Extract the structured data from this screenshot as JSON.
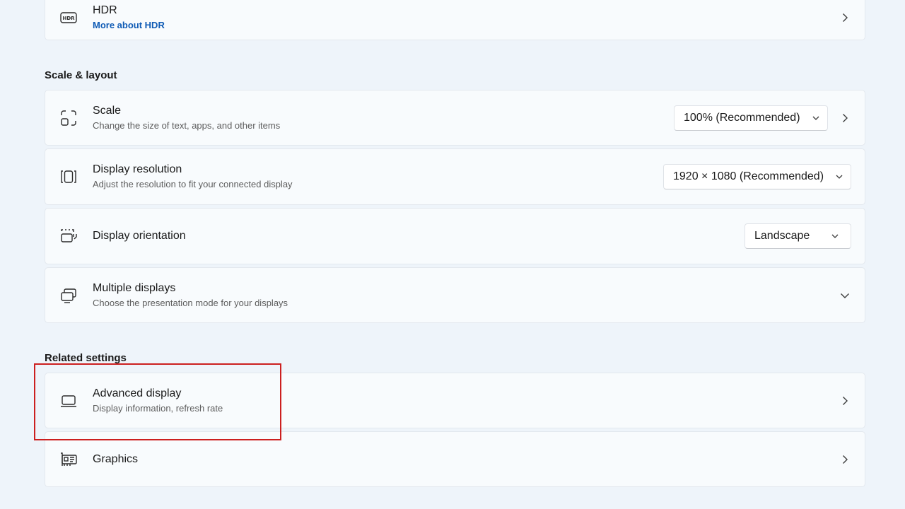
{
  "hdr": {
    "title": "HDR",
    "link": "More about HDR",
    "icon": "hdr-icon"
  },
  "sections": {
    "scale_layout": "Scale & layout",
    "related": "Related settings"
  },
  "scale": {
    "title": "Scale",
    "subtitle": "Change the size of text, apps, and other items",
    "value": "100% (Recommended)",
    "icon": "scale-icon"
  },
  "resolution": {
    "title": "Display resolution",
    "subtitle": "Adjust the resolution to fit your connected display",
    "value": "1920 × 1080 (Recommended)",
    "icon": "resolution-icon"
  },
  "orientation": {
    "title": "Display orientation",
    "value": "Landscape",
    "icon": "orientation-icon"
  },
  "multiple": {
    "title": "Multiple displays",
    "subtitle": "Choose the presentation mode for your displays",
    "icon": "multiple-displays-icon"
  },
  "advanced": {
    "title": "Advanced display",
    "subtitle": "Display information, refresh rate",
    "icon": "laptop-icon"
  },
  "graphics": {
    "title": "Graphics",
    "icon": "graphics-card-icon"
  },
  "colors": {
    "background": "#eef4fa",
    "card": "#f8fbfd",
    "link": "#0f5bb5",
    "highlight": "#cc1f1f"
  }
}
